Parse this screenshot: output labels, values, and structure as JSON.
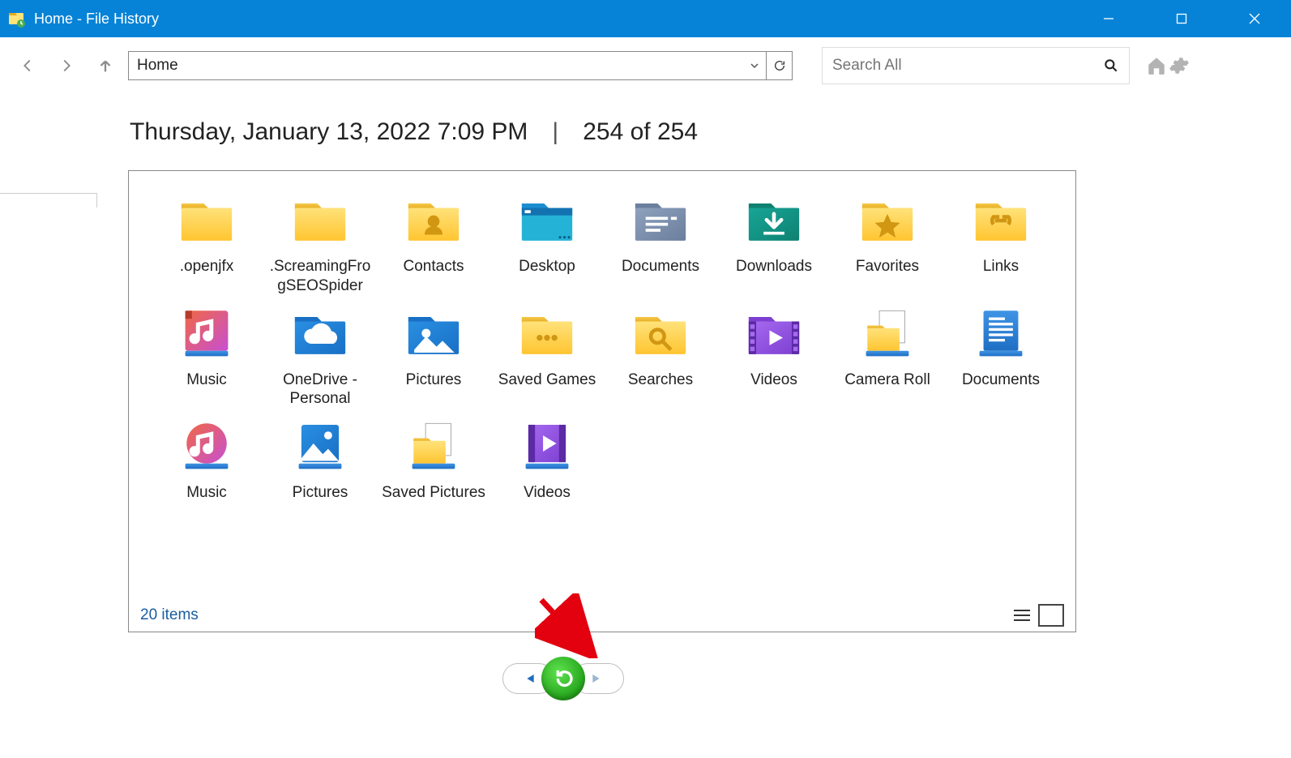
{
  "window": {
    "title": "Home - File History"
  },
  "nav": {
    "breadcrumb": "Home",
    "search_placeholder": "Search All"
  },
  "header": {
    "timestamp": "Thursday, January 13, 2022 7:09 PM",
    "position": "254 of 254"
  },
  "status": {
    "text": "20 items"
  },
  "items": [
    {
      "label": ".openjfx",
      "icon": "folder"
    },
    {
      "label": ".ScreamingFrogSEOSpider",
      "icon": "folder"
    },
    {
      "label": "Contacts",
      "icon": "folder-contacts"
    },
    {
      "label": "Desktop",
      "icon": "folder-desktop"
    },
    {
      "label": "Documents",
      "icon": "folder-documents"
    },
    {
      "label": "Downloads",
      "icon": "folder-downloads"
    },
    {
      "label": "Favorites",
      "icon": "folder-favorites"
    },
    {
      "label": "Links",
      "icon": "folder-links"
    },
    {
      "label": "Music",
      "icon": "lib-music"
    },
    {
      "label": "OneDrive - Personal",
      "icon": "folder-onedrive"
    },
    {
      "label": "Pictures",
      "icon": "folder-pictures"
    },
    {
      "label": "Saved Games",
      "icon": "folder-games"
    },
    {
      "label": "Searches",
      "icon": "folder-searches"
    },
    {
      "label": "Videos",
      "icon": "folder-videos"
    },
    {
      "label": "Camera Roll",
      "icon": "lib-camera"
    },
    {
      "label": "Documents",
      "icon": "lib-documents"
    },
    {
      "label": "Music",
      "icon": "lib-music-b"
    },
    {
      "label": "Pictures",
      "icon": "lib-pictures"
    },
    {
      "label": "Saved Pictures",
      "icon": "lib-savedpics"
    },
    {
      "label": "Videos",
      "icon": "lib-videos"
    }
  ]
}
